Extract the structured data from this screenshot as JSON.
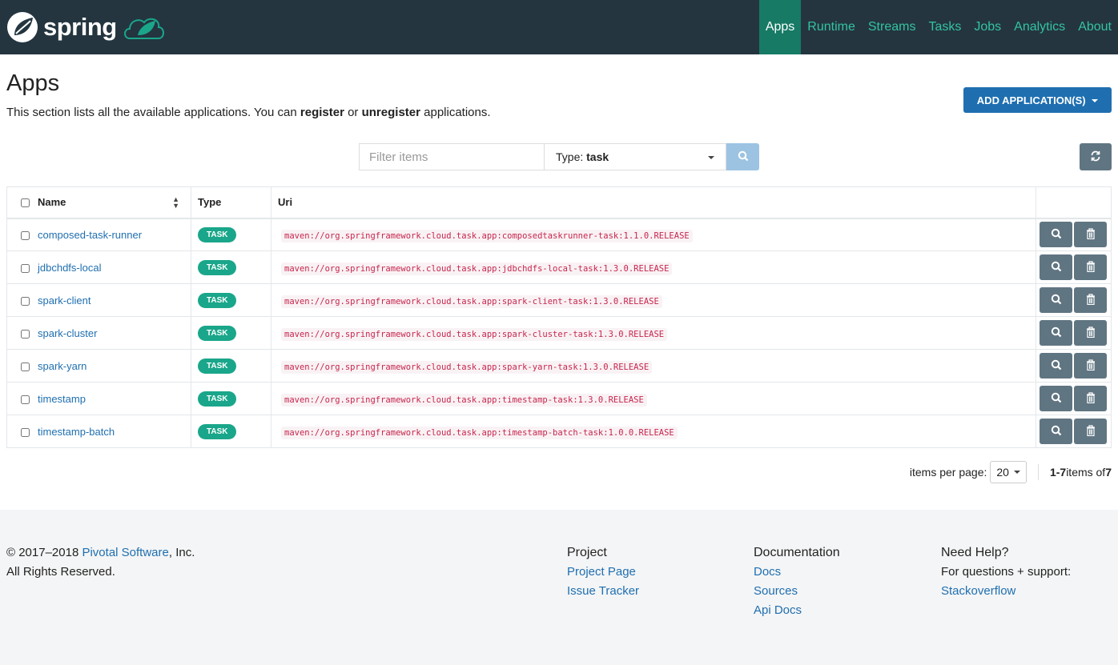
{
  "brand": {
    "name": "spring",
    "accent": "#34c3a0",
    "nav_bg": "#243540"
  },
  "nav": [
    {
      "label": "Apps",
      "active": true
    },
    {
      "label": "Runtime"
    },
    {
      "label": "Streams"
    },
    {
      "label": "Tasks"
    },
    {
      "label": "Jobs"
    },
    {
      "label": "Analytics"
    },
    {
      "label": "About"
    }
  ],
  "page": {
    "title": "Apps",
    "desc_pre": "This section lists all the available applications. You can ",
    "register": "register",
    "or": " or ",
    "unregister": "unregister",
    "desc_post": " applications.",
    "add_button": "ADD APPLICATION(S)"
  },
  "filter": {
    "placeholder": "Filter items",
    "type_label": "Type: ",
    "type_value": "task"
  },
  "table": {
    "headers": {
      "name": "Name",
      "type": "Type",
      "uri": "Uri"
    },
    "rows": [
      {
        "name": "composed-task-runner",
        "type": "TASK",
        "uri": "maven://org.springframework.cloud.task.app:composedtaskrunner-task:1.1.0.RELEASE"
      },
      {
        "name": "jdbchdfs-local",
        "type": "TASK",
        "uri": "maven://org.springframework.cloud.task.app:jdbchdfs-local-task:1.3.0.RELEASE"
      },
      {
        "name": "spark-client",
        "type": "TASK",
        "uri": "maven://org.springframework.cloud.task.app:spark-client-task:1.3.0.RELEASE"
      },
      {
        "name": "spark-cluster",
        "type": "TASK",
        "uri": "maven://org.springframework.cloud.task.app:spark-cluster-task:1.3.0.RELEASE"
      },
      {
        "name": "spark-yarn",
        "type": "TASK",
        "uri": "maven://org.springframework.cloud.task.app:spark-yarn-task:1.3.0.RELEASE"
      },
      {
        "name": "timestamp",
        "type": "TASK",
        "uri": "maven://org.springframework.cloud.task.app:timestamp-task:1.3.0.RELEASE"
      },
      {
        "name": "timestamp-batch",
        "type": "TASK",
        "uri": "maven://org.springframework.cloud.task.app:timestamp-batch-task:1.0.0.RELEASE"
      }
    ]
  },
  "pager": {
    "label": "items per page:",
    "per_page": "20",
    "range": "1-7",
    "of": " items of ",
    "total": "7"
  },
  "footer": {
    "copy": "© 2017–2018 ",
    "company": "Pivotal Software",
    "inc": ", Inc.",
    "rights": "All Rights Reserved.",
    "project": {
      "title": "Project",
      "links": [
        "Project Page",
        "Issue Tracker"
      ]
    },
    "docs": {
      "title": "Documentation",
      "links": [
        "Docs",
        "Sources",
        "Api Docs"
      ]
    },
    "help": {
      "title": "Need Help?",
      "text": "For questions + support:",
      "link": "Stackoverflow"
    }
  }
}
